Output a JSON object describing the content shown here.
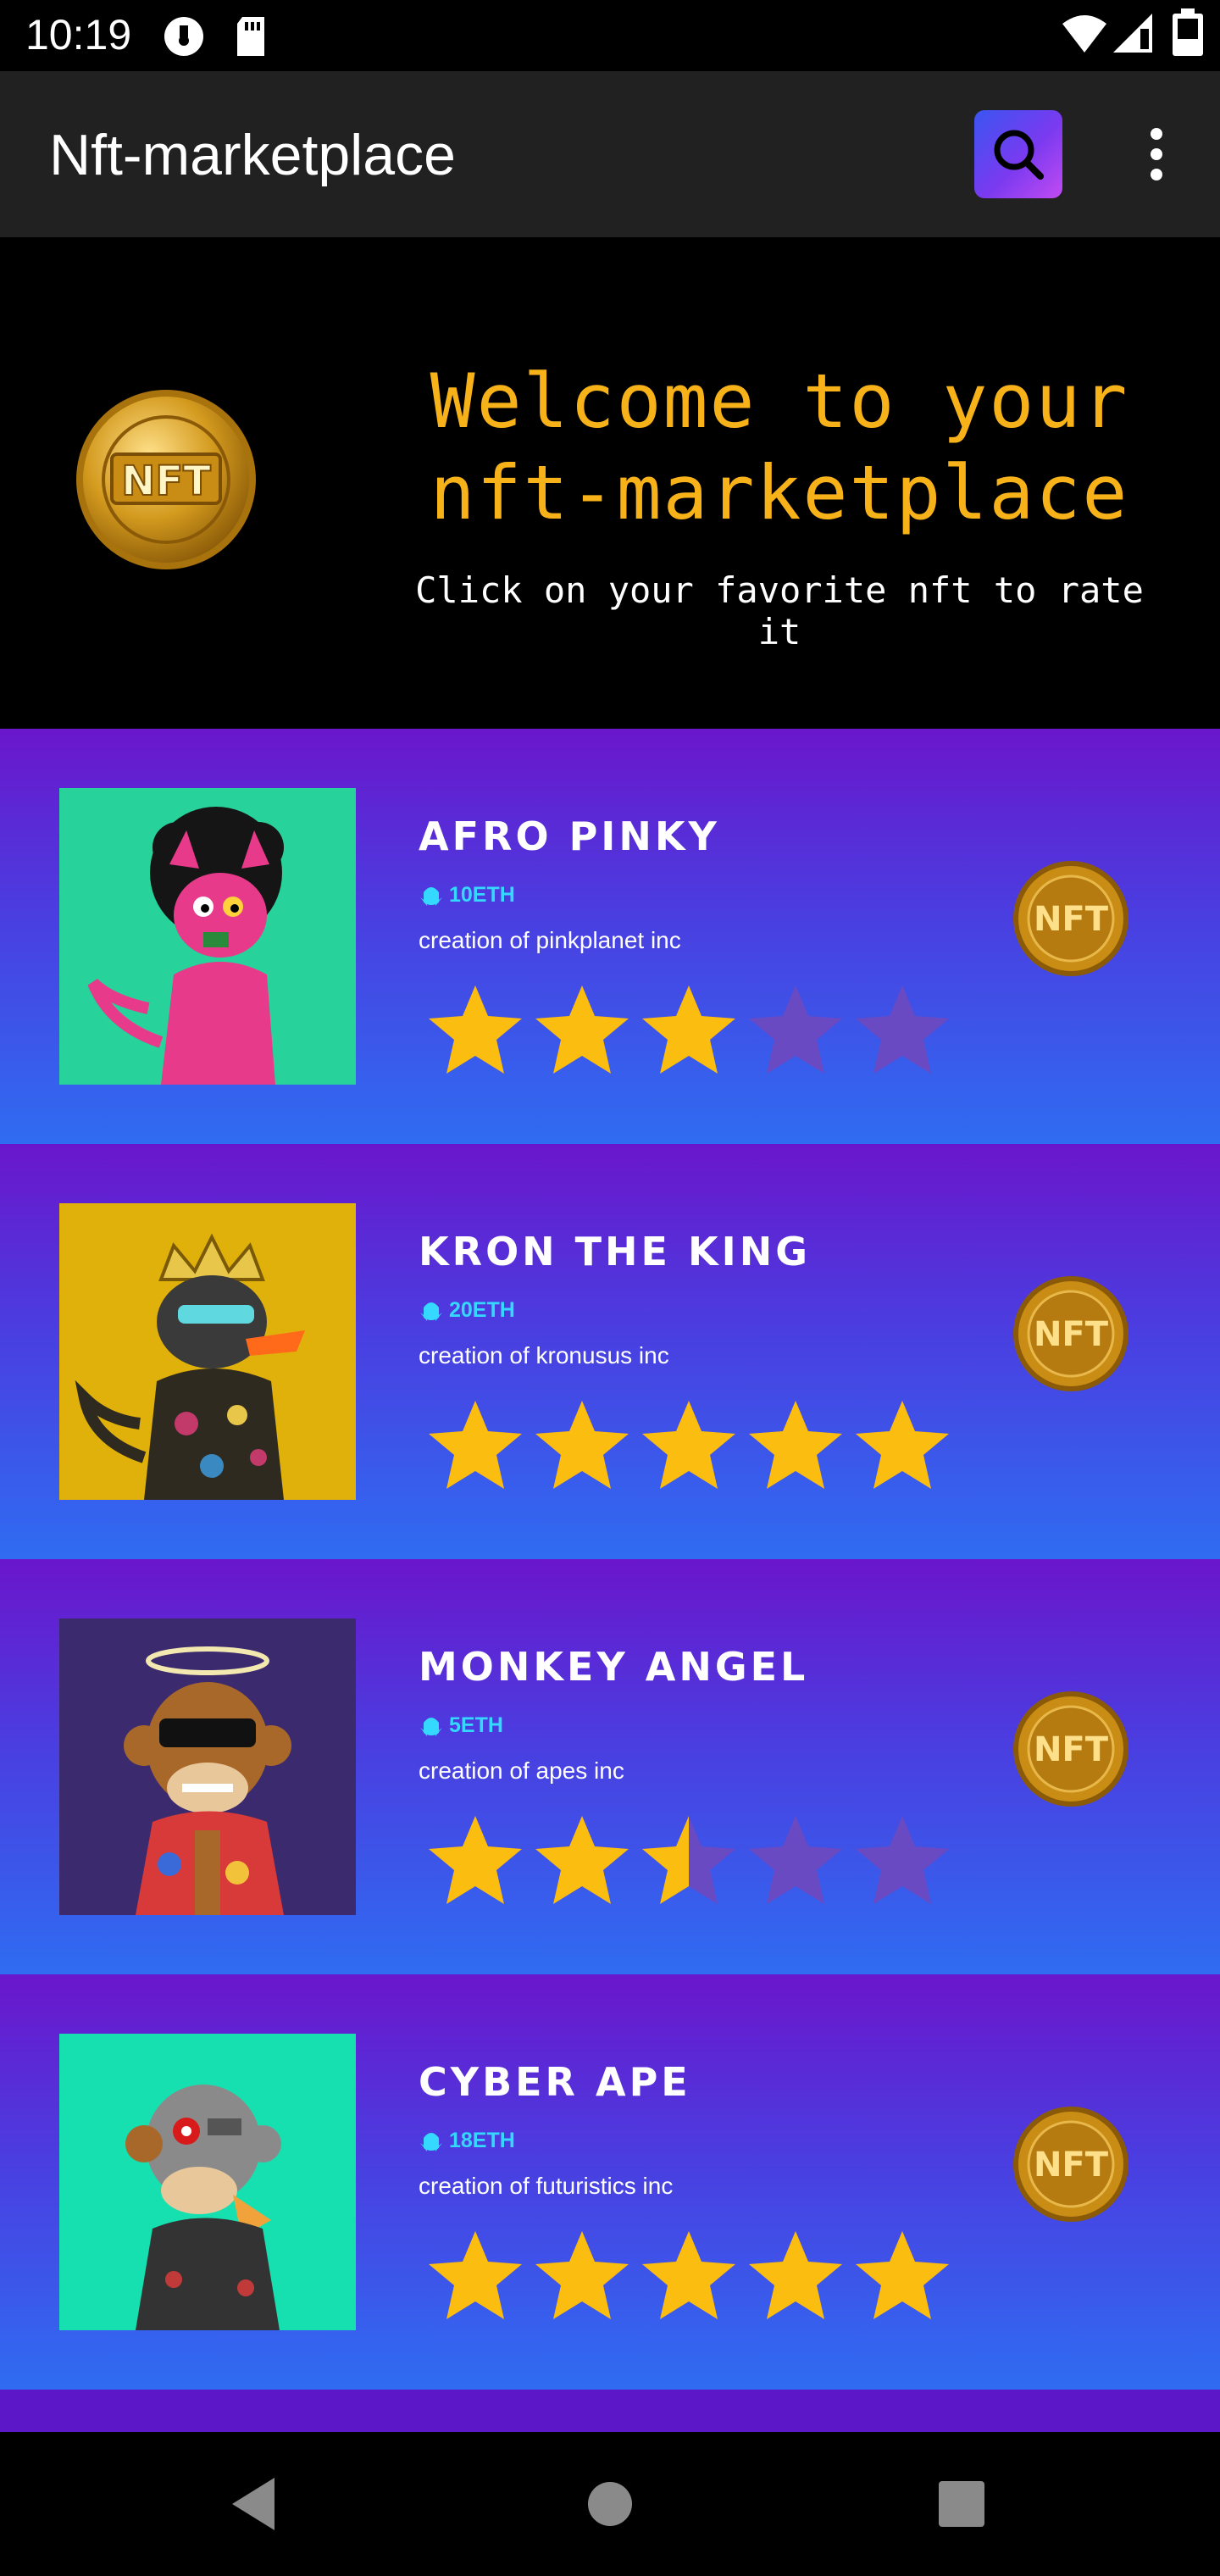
{
  "status_bar": {
    "time": "10:19",
    "icons": [
      "record-icon",
      "sd-card-icon",
      "wifi-icon",
      "signal-icon",
      "battery-icon"
    ]
  },
  "app_bar": {
    "title": "Nft-marketplace",
    "search_icon": "search-icon",
    "more_icon": "more-vertical-icon",
    "search_gradient": [
      "#3a55f0",
      "#c24bf2"
    ]
  },
  "hero": {
    "title": "Welcome to your nft-marketplace",
    "subtitle": "Click on your favorite nft to rate it",
    "logo_text": "NFT",
    "title_color": "#f7b21a"
  },
  "items": [
    {
      "name": "AFRO PINKY",
      "price": "10ETH",
      "creator": "creation of pinkplanet inc",
      "rating": 3,
      "image_bg": "#27d39a",
      "badge_text": "NFT"
    },
    {
      "name": "KRON THE KING",
      "price": "20ETH",
      "creator": "creation of kronusus inc",
      "rating": 5,
      "image_bg": "#e0b10a",
      "badge_text": "NFT"
    },
    {
      "name": "MONKEY ANGEL",
      "price": "5ETH",
      "creator": "creation of apes inc",
      "rating": 2.5,
      "image_bg": "#3b2a6e",
      "badge_text": "NFT"
    },
    {
      "name": "CYBER APE",
      "price": "18ETH",
      "creator": "creation of futuristics inc",
      "rating": 5,
      "image_bg": "#17e0b0",
      "badge_text": "NFT"
    }
  ],
  "colors": {
    "star_filled": "#fbbd10",
    "star_empty": "#6a4ac2",
    "price": "#35d8ff"
  },
  "nav_bar": {
    "icons": [
      "back-icon",
      "home-icon",
      "recents-icon"
    ]
  }
}
